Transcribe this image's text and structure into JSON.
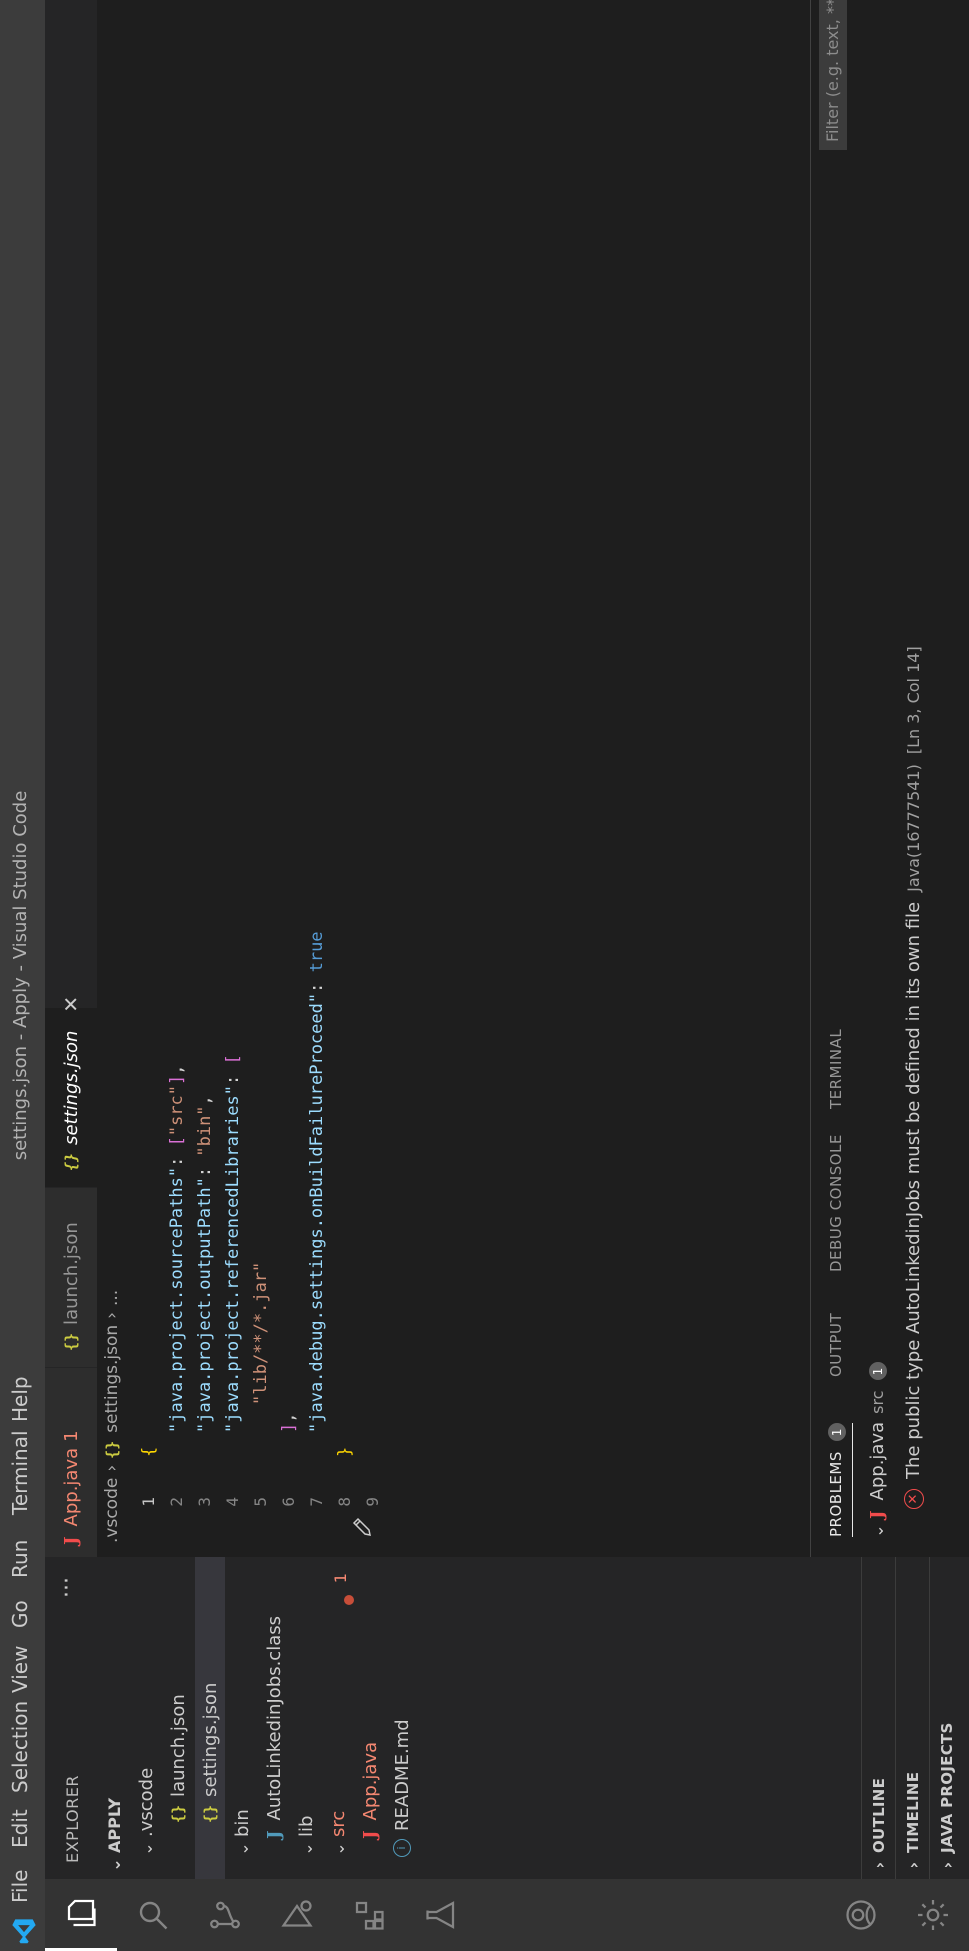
{
  "window": {
    "title": "settings.json - Apply - Visual Studio Code"
  },
  "menu": [
    "File",
    "Edit",
    "Selection",
    "View",
    "Go",
    "Run",
    "Terminal",
    "Help"
  ],
  "activity_bar": {
    "items": [
      "files-icon",
      "search-icon",
      "source-control-icon",
      "run-debug-icon",
      "extensions-icon",
      "testing-icon"
    ],
    "bottom": [
      "accounts-icon",
      "manage-gear-icon"
    ]
  },
  "sidebar": {
    "title": "EXPLORER",
    "more": "···",
    "root": "APPLY",
    "tree": [
      {
        "label": ".vscode",
        "type": "folder"
      },
      {
        "label": "launch.json",
        "type": "json"
      },
      {
        "label": "settings.json",
        "type": "json"
      },
      {
        "label": "bin",
        "type": "folder"
      },
      {
        "label": "AutoLinkedinJobs.class",
        "type": "java"
      },
      {
        "label": "lib",
        "type": "folder"
      },
      {
        "label": "src",
        "type": "folder",
        "errors": "1"
      },
      {
        "label": "App.java",
        "type": "java"
      },
      {
        "label": "README.md",
        "type": "info"
      }
    ],
    "sections": [
      "OUTLINE",
      "TIMELINE",
      "JAVA PROJECTS"
    ]
  },
  "tabs": [
    {
      "label": "App.java",
      "badge": "1"
    },
    {
      "label": "launch.json"
    },
    {
      "label": "settings.json",
      "close": "✕"
    }
  ],
  "breadcrumb": {
    "folder": ".vscode",
    "file": "settings.json",
    "tail": "..."
  },
  "editor": {
    "line_numbers": [
      "1",
      "2",
      "3",
      "4",
      "5",
      "6",
      "7",
      "8",
      "9"
    ],
    "lines": {
      "l1": "{",
      "l2_key": "\"java.project.sourcePaths\"",
      "l2_colon": ": ",
      "l2_open": "[",
      "l2_val": "\"src\"",
      "l2_close": "]",
      "l2_end": ",",
      "l3_key": "\"java.project.outputPath\"",
      "l3_colon": ": ",
      "l3_val": "\"bin\"",
      "l3_end": ",",
      "l4_key": "\"java.project.referencedLibraries\"",
      "l4_colon": ": ",
      "l4_open": "[",
      "l5_val": "\"lib/**/*.jar\"",
      "l6_close": "]",
      "l6_end": ",",
      "l7_key": "\"java.debug.settings.onBuildFailureProceed\"",
      "l7_colon": ": ",
      "l7_val": "true",
      "l8": "}"
    }
  },
  "panel": {
    "tabs": [
      "PROBLEMS",
      "OUTPUT",
      "DEBUG CONSOLE",
      "TERMINAL"
    ],
    "problems_badge": "1",
    "filter_placeholder": "Filter (e.g. text, **/*.ts, !**/node_modules/**)",
    "file": {
      "name": "App.java",
      "path": "src",
      "count": "1"
    },
    "problem": {
      "message": "The public type AutoLinkedinJobs must be defined in its own file",
      "source": "Java(16777541)",
      "location": "[Ln 3, Col 14]"
    }
  },
  "colors": {
    "error": "#f14c4c",
    "json_icon": "#cbcb41",
    "java_icon": "#f14c4c",
    "accent_blue": "#007acc"
  }
}
